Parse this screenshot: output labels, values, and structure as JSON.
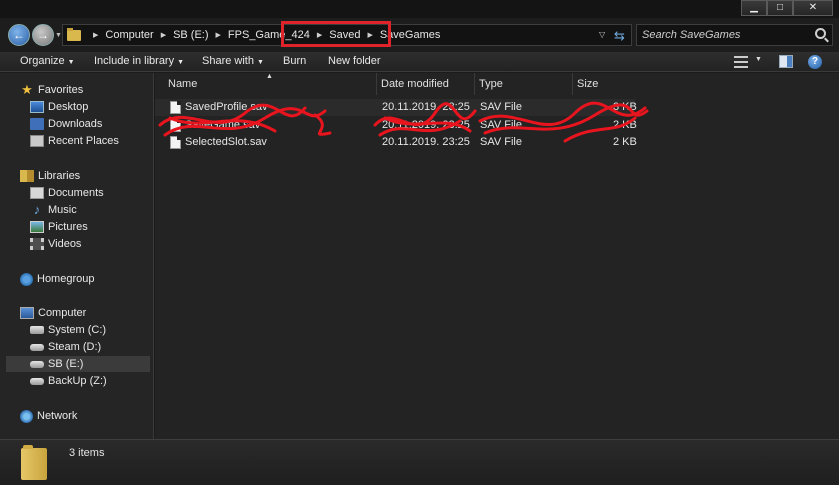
{
  "window": {
    "controls": {
      "minimize": "▁",
      "maximize": "□",
      "close": "✕"
    }
  },
  "nav": {
    "back_icon": "arrow-left-icon",
    "forward_icon": "arrow-right-icon",
    "recent_icon": "chevron-down-icon"
  },
  "address": {
    "breadcrumb": [
      "Computer",
      "SB (E:)",
      "FPS_Game_424",
      "Saved",
      "SaveGames"
    ],
    "highlight_color": "#e0222a"
  },
  "search": {
    "placeholder": "Search SaveGames"
  },
  "toolbar": {
    "organize": "Organize",
    "include_in_library": "Include in library",
    "share_with": "Share with",
    "burn": "Burn",
    "new_folder": "New folder"
  },
  "sidebar": {
    "favorites": {
      "label": "Favorites",
      "items": [
        "Desktop",
        "Downloads",
        "Recent Places"
      ]
    },
    "libraries": {
      "label": "Libraries",
      "items": [
        "Documents",
        "Music",
        "Pictures",
        "Videos"
      ]
    },
    "homegroup": {
      "label": "Homegroup"
    },
    "computer": {
      "label": "Computer",
      "items": [
        "System (C:)",
        "Steam (D:)",
        "SB (E:)",
        "BackUp (Z:)"
      ],
      "selected": "SB (E:)"
    },
    "network": {
      "label": "Network"
    }
  },
  "columns": {
    "name": "Name",
    "date_modified": "Date modified",
    "type": "Type",
    "size": "Size"
  },
  "files": [
    {
      "name": "SavedProfile.sav",
      "date": "20.11.2019. 23:25",
      "type": "SAV File",
      "size": "3 KB"
    },
    {
      "name": "SaveGame.sav",
      "date": "20.11.2019. 23:25",
      "type": "SAV File",
      "size": "2 KB"
    },
    {
      "name": "SelectedSlot.sav",
      "date": "20.11.2019. 23:25",
      "type": "SAV File",
      "size": "2 KB"
    }
  ],
  "redaction_color": "#e8141e",
  "status": {
    "item_count": "3 items"
  }
}
